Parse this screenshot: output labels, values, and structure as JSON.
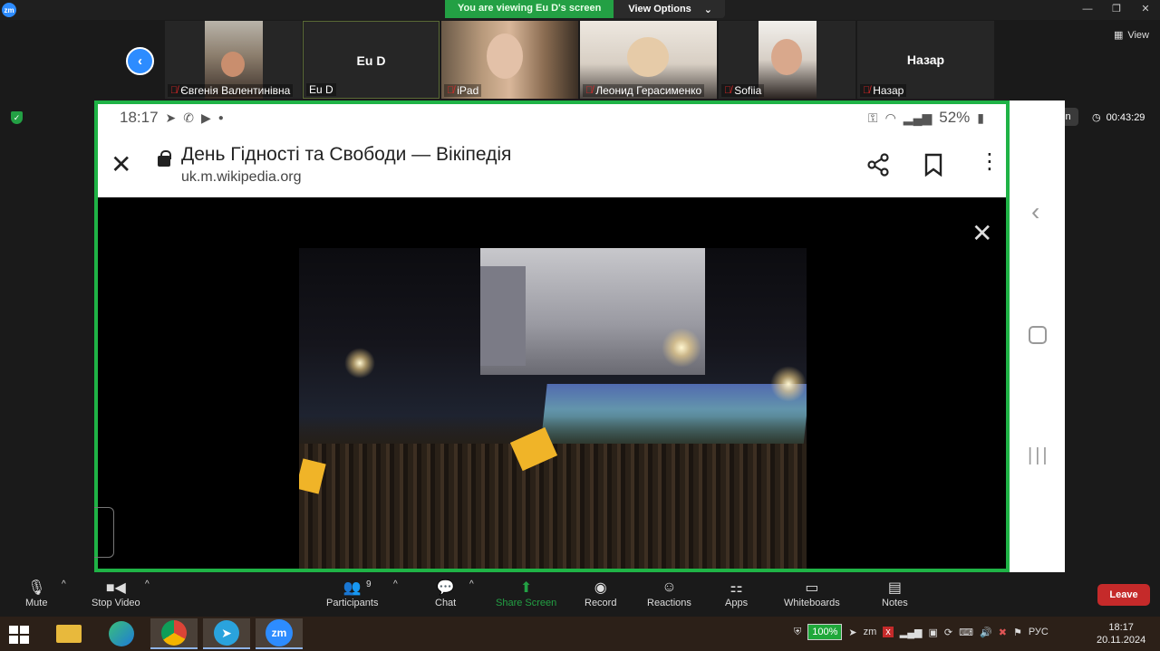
{
  "titlebar": {
    "viewing_text": "You are viewing Eu D's screen",
    "view_options_label": "View Options",
    "zoom_logo": "zm",
    "window_controls": [
      "—",
      "❐",
      "✕"
    ]
  },
  "thumbnails": {
    "prev_icon": "chevron-left-icon",
    "view_label": "View",
    "tiles": [
      {
        "name": "Євгенія Валентинівна",
        "muted": true,
        "video": true
      },
      {
        "name": "Eu D",
        "center_name": "Eu D",
        "muted": false,
        "video": false
      },
      {
        "name": "iPad",
        "muted": true,
        "video": true
      },
      {
        "name": "Леонид Герасименко",
        "muted": true,
        "video": true
      },
      {
        "name": "Sofiia",
        "muted": true,
        "video": true
      },
      {
        "name": "Назар",
        "center_name": "Назар",
        "muted": true,
        "video": false
      }
    ]
  },
  "status": {
    "sign_in_label": "Sign in",
    "timer": "00:43:29"
  },
  "shared_screen": {
    "phone_time": "18:17",
    "phone_battery": "52%",
    "page_title": "День Гідності та Свободи — Вікіпедія",
    "page_url": "uk.m.wikipedia.org",
    "photo_description_icon": "maidan-night-photo"
  },
  "toolbar": {
    "mute_label": "Mute",
    "stop_video_label": "Stop Video",
    "participants_label": "Participants",
    "participants_count": "9",
    "chat_label": "Chat",
    "share_screen_label": "Share Screen",
    "record_label": "Record",
    "reactions_label": "Reactions",
    "apps_label": "Apps",
    "whiteboards_label": "Whiteboards",
    "notes_label": "Notes",
    "leave_label": "Leave"
  },
  "taskbar": {
    "battery": "100%",
    "language": "РУС",
    "time": "18:17",
    "date": "20.11.2024",
    "zoom_app_label": "zm"
  },
  "colors": {
    "share_border": "#1fb346",
    "accent_blue": "#2d8cff",
    "leave_red": "#c52a2a",
    "banner_green": "#23a044"
  }
}
